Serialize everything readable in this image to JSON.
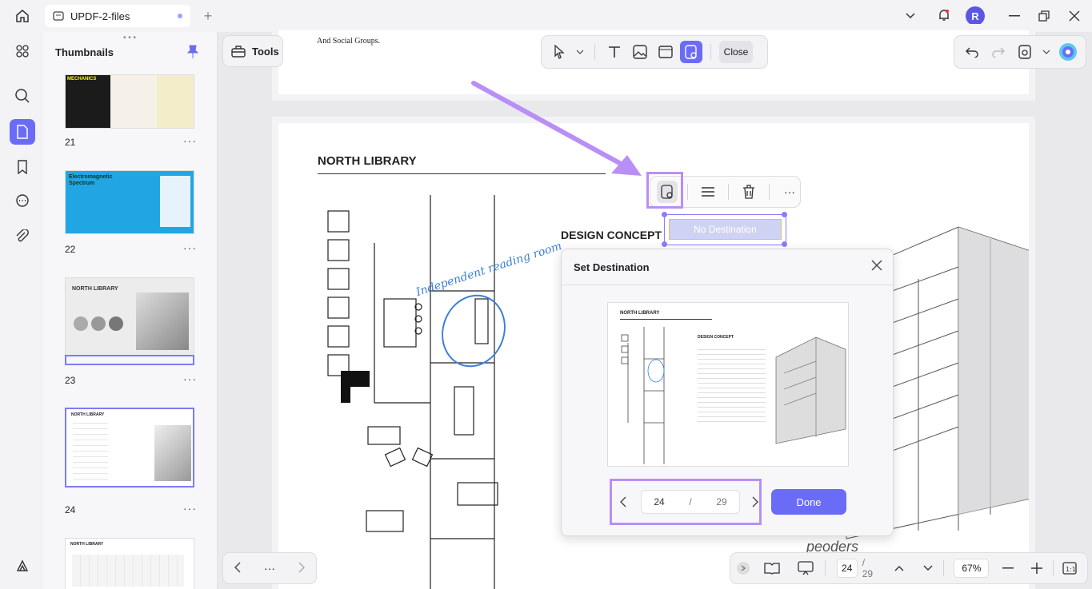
{
  "tab": {
    "title": "UPDF-2-files"
  },
  "thumbnails": {
    "title": "Thumbnails",
    "pages": [
      {
        "num": "21",
        "label": "MECHANICS"
      },
      {
        "num": "22",
        "label": "Electromagnetic Spectrum"
      },
      {
        "num": "23",
        "label": "NORTH LIBRARY"
      },
      {
        "num": "24",
        "label": "NORTH LIBRARY"
      },
      {
        "num": "",
        "label": "NORTH LIBRARY"
      }
    ],
    "more": "···"
  },
  "toolbar": {
    "tools_label": "Tools",
    "close_label": "Close"
  },
  "document": {
    "top_snippet": "And Social Groups.",
    "heading": "NORTH LIBRARY",
    "design_concept": "DESIGN CONCEPT",
    "handwriting": "Independent reading room",
    "link_placeholder": "No Destination",
    "bottom_handwriting": "peoders"
  },
  "dialog": {
    "title": "Set Destination",
    "current_page": "24",
    "separator": "/",
    "total_pages": "29",
    "done_label": "Done"
  },
  "preview": {
    "heading": "NORTH LIBRARY",
    "concept": "DESIGN CONCEPT"
  },
  "statusbar": {
    "page_current": "24",
    "page_total": "/ 29",
    "zoom": "67%",
    "more": "···"
  },
  "colors": {
    "accent": "#6b6cf5",
    "highlight": "#b88ff5"
  }
}
